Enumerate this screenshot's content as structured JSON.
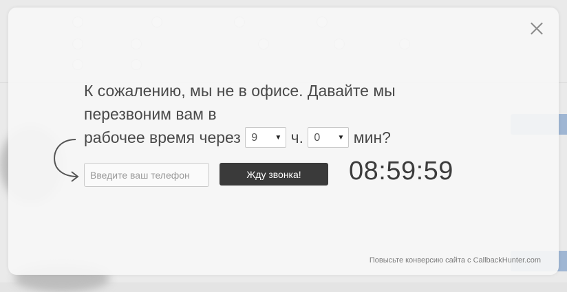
{
  "modal": {
    "headline_line1": "К сожалению, мы не в офисе. Давайте мы",
    "headline_line2": "перезвоним вам в",
    "headline_line3_prefix": "рабочее время через",
    "hours_value": "9",
    "hours_unit": "ч.",
    "minutes_value": "0",
    "minutes_unit": "мин?",
    "phone_placeholder": "Введите ваш телефон",
    "call_button_label": "Жду звонка!",
    "timer": "08:59:59",
    "footer_text": "Повысьте конверсию сайта с CallbackHunter.com"
  },
  "icons": {
    "close": "close-icon",
    "arrow": "curved-arrow-icon",
    "dropdown": "chevron-down-icon"
  }
}
